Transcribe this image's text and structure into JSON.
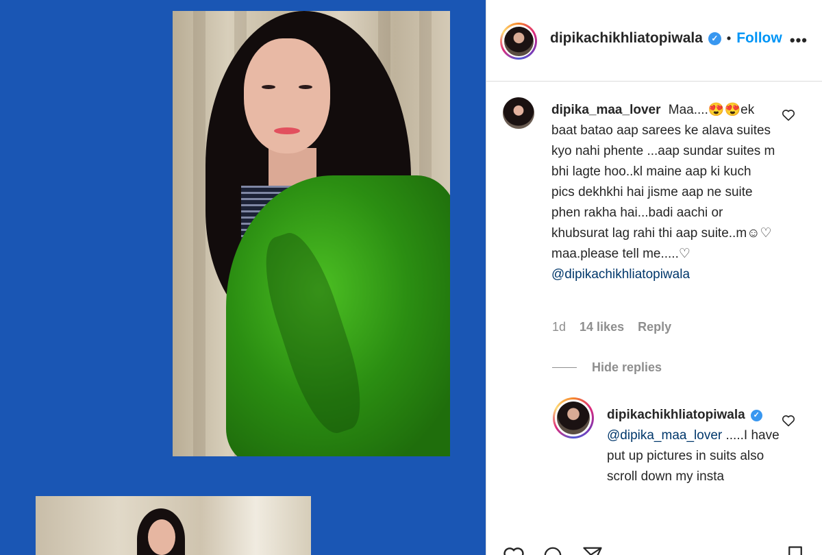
{
  "post": {
    "username": "dipikachikhliatopiwala",
    "verified_mark": "✓",
    "separator": "•",
    "follow_label": "Follow",
    "more_label": "•••"
  },
  "comment": {
    "username": "dipika_maa_lover",
    "text": "Maa....😍😍ek baat batao aap sarees ke alava suites kyo nahi phente ...aap sundar suites m bhi lagte hoo..kl maine aap ki kuch pics dekhkhi hai jisme aap ne suite phen rakha hai...badi aachi or khubsurat lag rahi thi aap suite..m☺♡ maa.please tell me.....♡",
    "mention": "@dipikachikhliatopiwala",
    "age": "1d",
    "likes": "14 likes",
    "reply_label": "Reply",
    "hide_replies_label": "Hide replies"
  },
  "reply": {
    "username": "dipikachikhliatopiwala",
    "verified_mark": "✓",
    "mention": "@dipika_maa_lover",
    "text": ".....I have put up pictures in suits also scroll down my insta"
  },
  "colors": {
    "background_blue": "#1a56b4",
    "follow_blue": "#0095f6",
    "verified_blue": "#3897f0",
    "mention_blue": "#00376b",
    "scarf_green": "#2b8e12"
  },
  "icons": {
    "more": "more-options-icon",
    "heart": "heart-icon",
    "comment": "comment-icon",
    "share": "share-icon",
    "save": "bookmark-icon"
  }
}
